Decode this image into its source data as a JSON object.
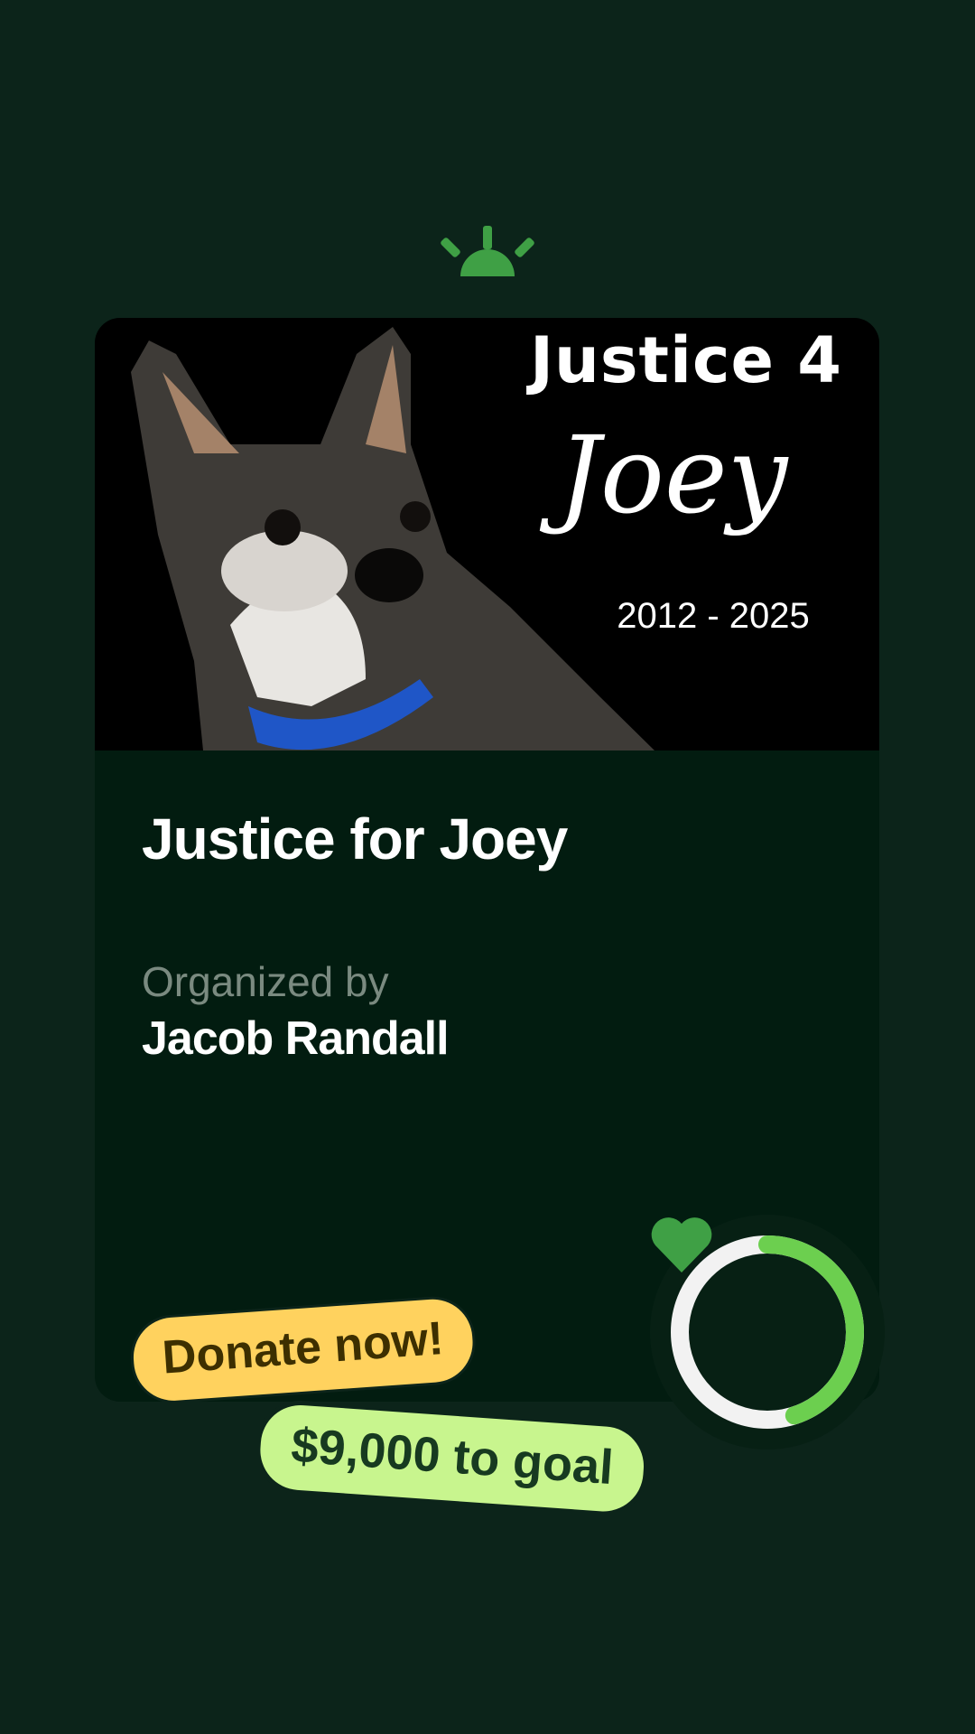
{
  "logo": {
    "icon": "sunrise-logo-icon",
    "color": "#3fa045"
  },
  "campaign": {
    "photo": {
      "title": "Justice 4",
      "name": "Joey",
      "years": "2012 - 2025",
      "subject": "dog-portrait"
    },
    "title": "Justice for Joey",
    "organized_label": "Organized by",
    "organizer": "Jacob Randall"
  },
  "progress": {
    "fraction": 0.45,
    "icon": "heart-icon",
    "colors": {
      "fill": "#6ccf4f",
      "track": "#f2f2f2",
      "heart": "#3fa045"
    }
  },
  "actions": {
    "donate_label": "Donate now!",
    "goal_label": "$9,000 to goal"
  },
  "colors": {
    "background": "#0c241a",
    "card": "#021c10",
    "donate": "#ffd25e",
    "goal": "#c8f58e"
  }
}
